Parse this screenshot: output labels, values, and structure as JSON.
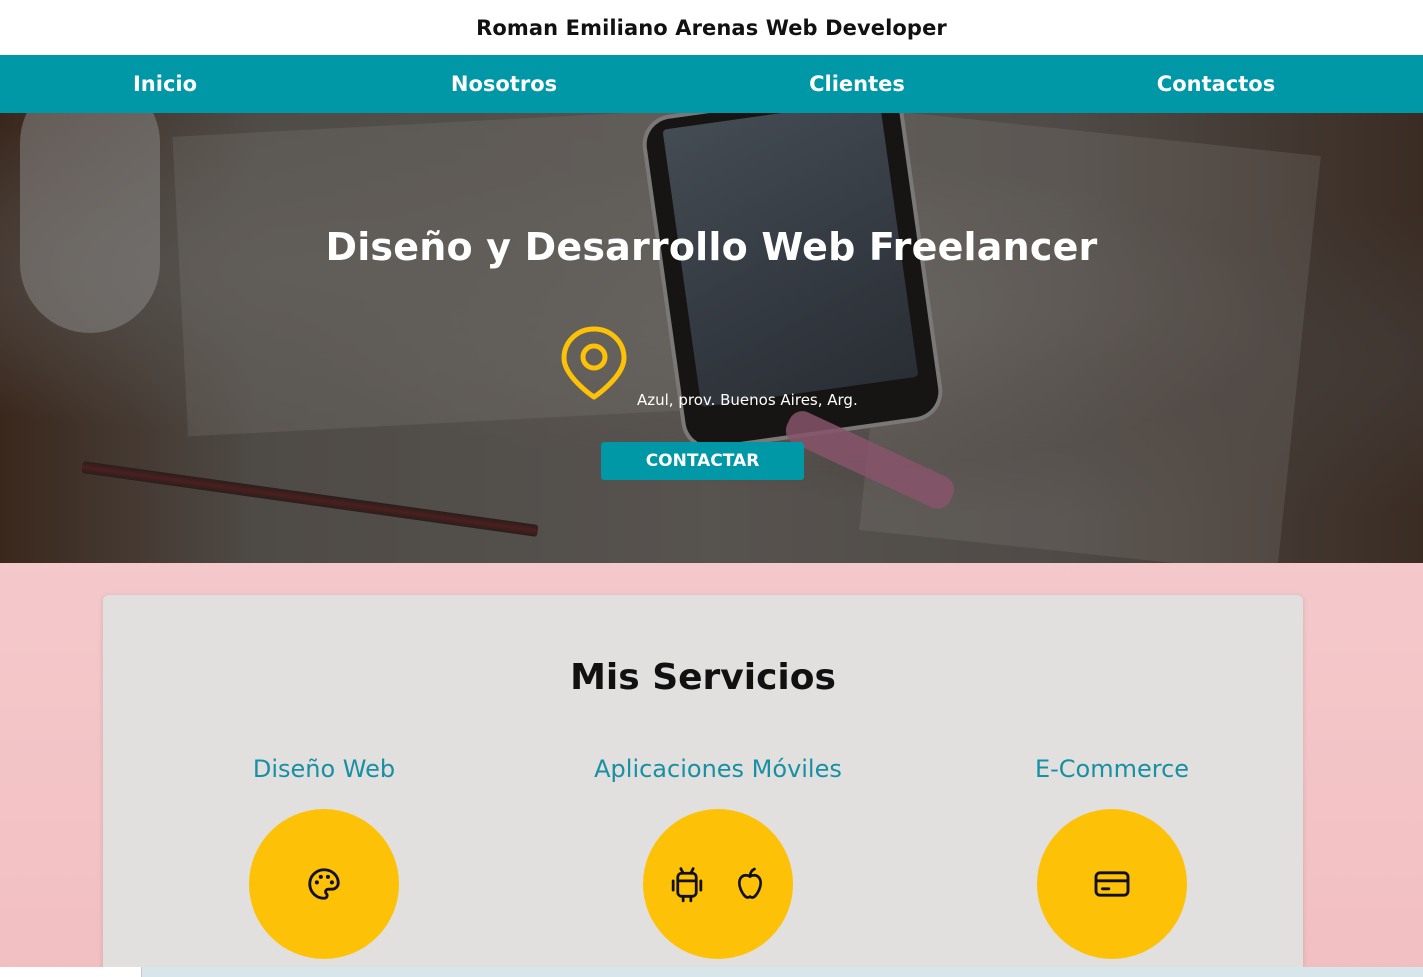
{
  "header": {
    "brand": "Roman Emiliano Arenas Web Developer"
  },
  "nav": {
    "items": [
      {
        "label": "Inicio"
      },
      {
        "label": "Nosotros"
      },
      {
        "label": "Clientes"
      },
      {
        "label": "Contactos"
      }
    ]
  },
  "hero": {
    "title": "Diseño y Desarrollo Web Freelancer",
    "location": "Azul, prov. Buenos Aires, Arg.",
    "cta_label": "CONTACTAR"
  },
  "services": {
    "heading": "Mis Servicios",
    "items": [
      {
        "title": "Diseño Web",
        "icons": [
          "palette-icon"
        ]
      },
      {
        "title": "Aplicaciones Móviles",
        "icons": [
          "android-icon",
          "apple-icon"
        ]
      },
      {
        "title": "E-Commerce",
        "icons": [
          "credit-card-icon"
        ]
      }
    ]
  },
  "colors": {
    "nav_bg": "#0097a7",
    "accent_yellow": "#fdc107",
    "service_title": "#1790a3",
    "card_bg": "#e2dfdf",
    "page_bg": "#f4c8cb"
  }
}
